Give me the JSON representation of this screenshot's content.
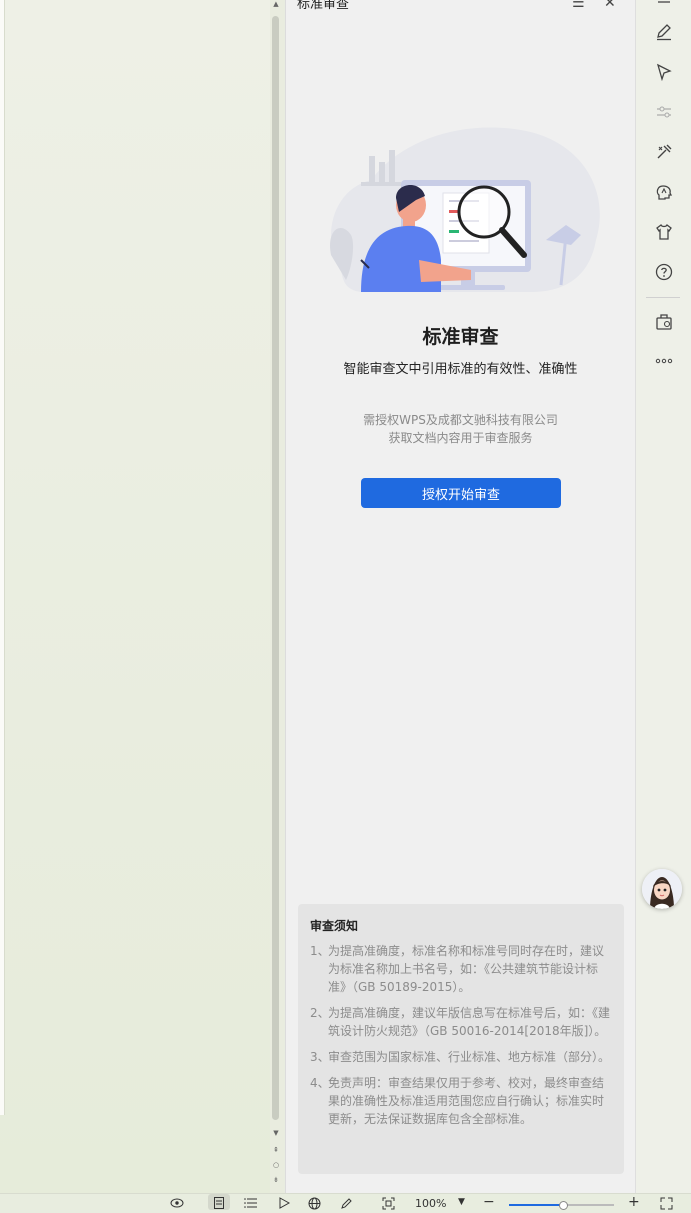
{
  "panel": {
    "title": "标准审查",
    "main_title": "标准审查",
    "subtitle": "智能审查文中引用标准的有效性、准确性",
    "note_line1": "需授权WPS及成都文驰科技有限公司",
    "note_line2": "获取文档内容用于审查服务",
    "auth_button": "授权开始审查"
  },
  "notice": {
    "title": "审查须知",
    "items": [
      {
        "num": "1、",
        "text": "为提高准确度，标准名称和标准号同时存在时，建议为标准名称加上书名号，如：《公共建筑节能设计标准》（GB 50189-2015）。"
      },
      {
        "num": "2、",
        "text": "为提高准确度，建议年版信息写在标准号后，如：《建筑设计防火规范》（GB 50016-2014[2018年版]）。"
      },
      {
        "num": "3、",
        "text": "审查范围为国家标准、行业标准、地方标准（部分）。"
      },
      {
        "num": "4、",
        "text": "免责声明：审查结果仅用于参考、校对，最终审查结果的准确性及标准适用范围您应自行确认；标准实时更新，无法保证数据库包含全部标准。"
      }
    ]
  },
  "toolbar": {
    "icons": [
      "pen-icon",
      "select-icon",
      "adjust-icon",
      "tools-icon",
      "brain-icon",
      "shirt-icon",
      "help-icon",
      "briefcase-icon",
      "more-icon"
    ]
  },
  "statusbar": {
    "zoom": "100%"
  },
  "colors": {
    "accent": "#1f6ae0",
    "panel_bg": "#f0f0f0"
  }
}
